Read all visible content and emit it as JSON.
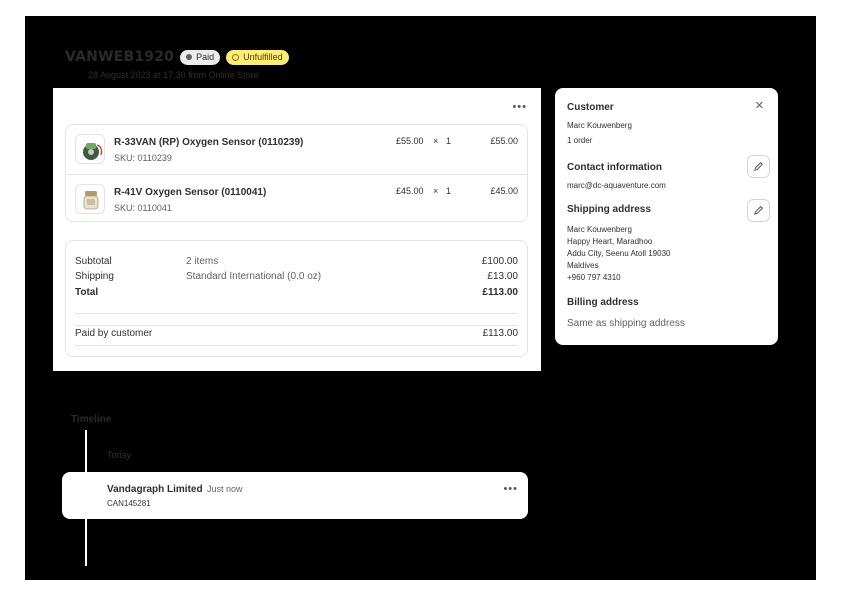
{
  "order": {
    "id": "VANWEB1920",
    "payment_badge": "Paid",
    "fulfillment_badge": "Unfulfilled",
    "subtitle": "28 August 2023 at 17:30 from Online Store"
  },
  "items": [
    {
      "name": "R-33VAN (RP) Oxygen Sensor (0110239)",
      "sku": "SKU: 0110239",
      "price": "£55.00",
      "times": "×",
      "qty": "1",
      "total": "£55.00",
      "icon": "oxygen-sensor-green-icon"
    },
    {
      "name": "R-41V Oxygen Sensor (0110041)",
      "sku": "SKU: 0110041",
      "price": "£45.00",
      "times": "×",
      "qty": "1",
      "total": "£45.00",
      "icon": "oxygen-sensor-white-icon"
    }
  ],
  "totals": {
    "subtotal_label": "Subtotal",
    "subtotal_desc": "2 items",
    "subtotal_value": "£100.00",
    "shipping_label": "Shipping",
    "shipping_desc": "Standard International (0.0 oz)",
    "shipping_value": "£13.00",
    "total_label": "Total",
    "total_value": "£113.00",
    "paid_label": "Paid by customer",
    "paid_value": "£113.00"
  },
  "customer": {
    "heading": "Customer",
    "close": "✕",
    "name": "Marc Kouwenberg",
    "orders": "1 order",
    "contact_heading": "Contact information",
    "email": "marc@dc-aquaventure.com",
    "shipping_heading": "Shipping address",
    "shipping_lines": [
      "Marc Kouwenberg",
      "Happy Heart, Maradhoo",
      "Addu City, Seenu Atoll 19030",
      "Maldives",
      "+960 797 4310"
    ],
    "billing_heading": "Billing address",
    "billing_text": "Same as shipping address"
  },
  "timeline": {
    "heading": "Timeline",
    "today": "Today",
    "event_name": "Vandagraph Limited",
    "event_time": "Just now",
    "event_code": "CAN145281"
  },
  "menu_dots": "•••",
  "colors": {
    "background": "#000000",
    "card": "#ffffff",
    "unfulfilled_badge": "#ffeb78",
    "paid_badge": "#ebebeb"
  }
}
